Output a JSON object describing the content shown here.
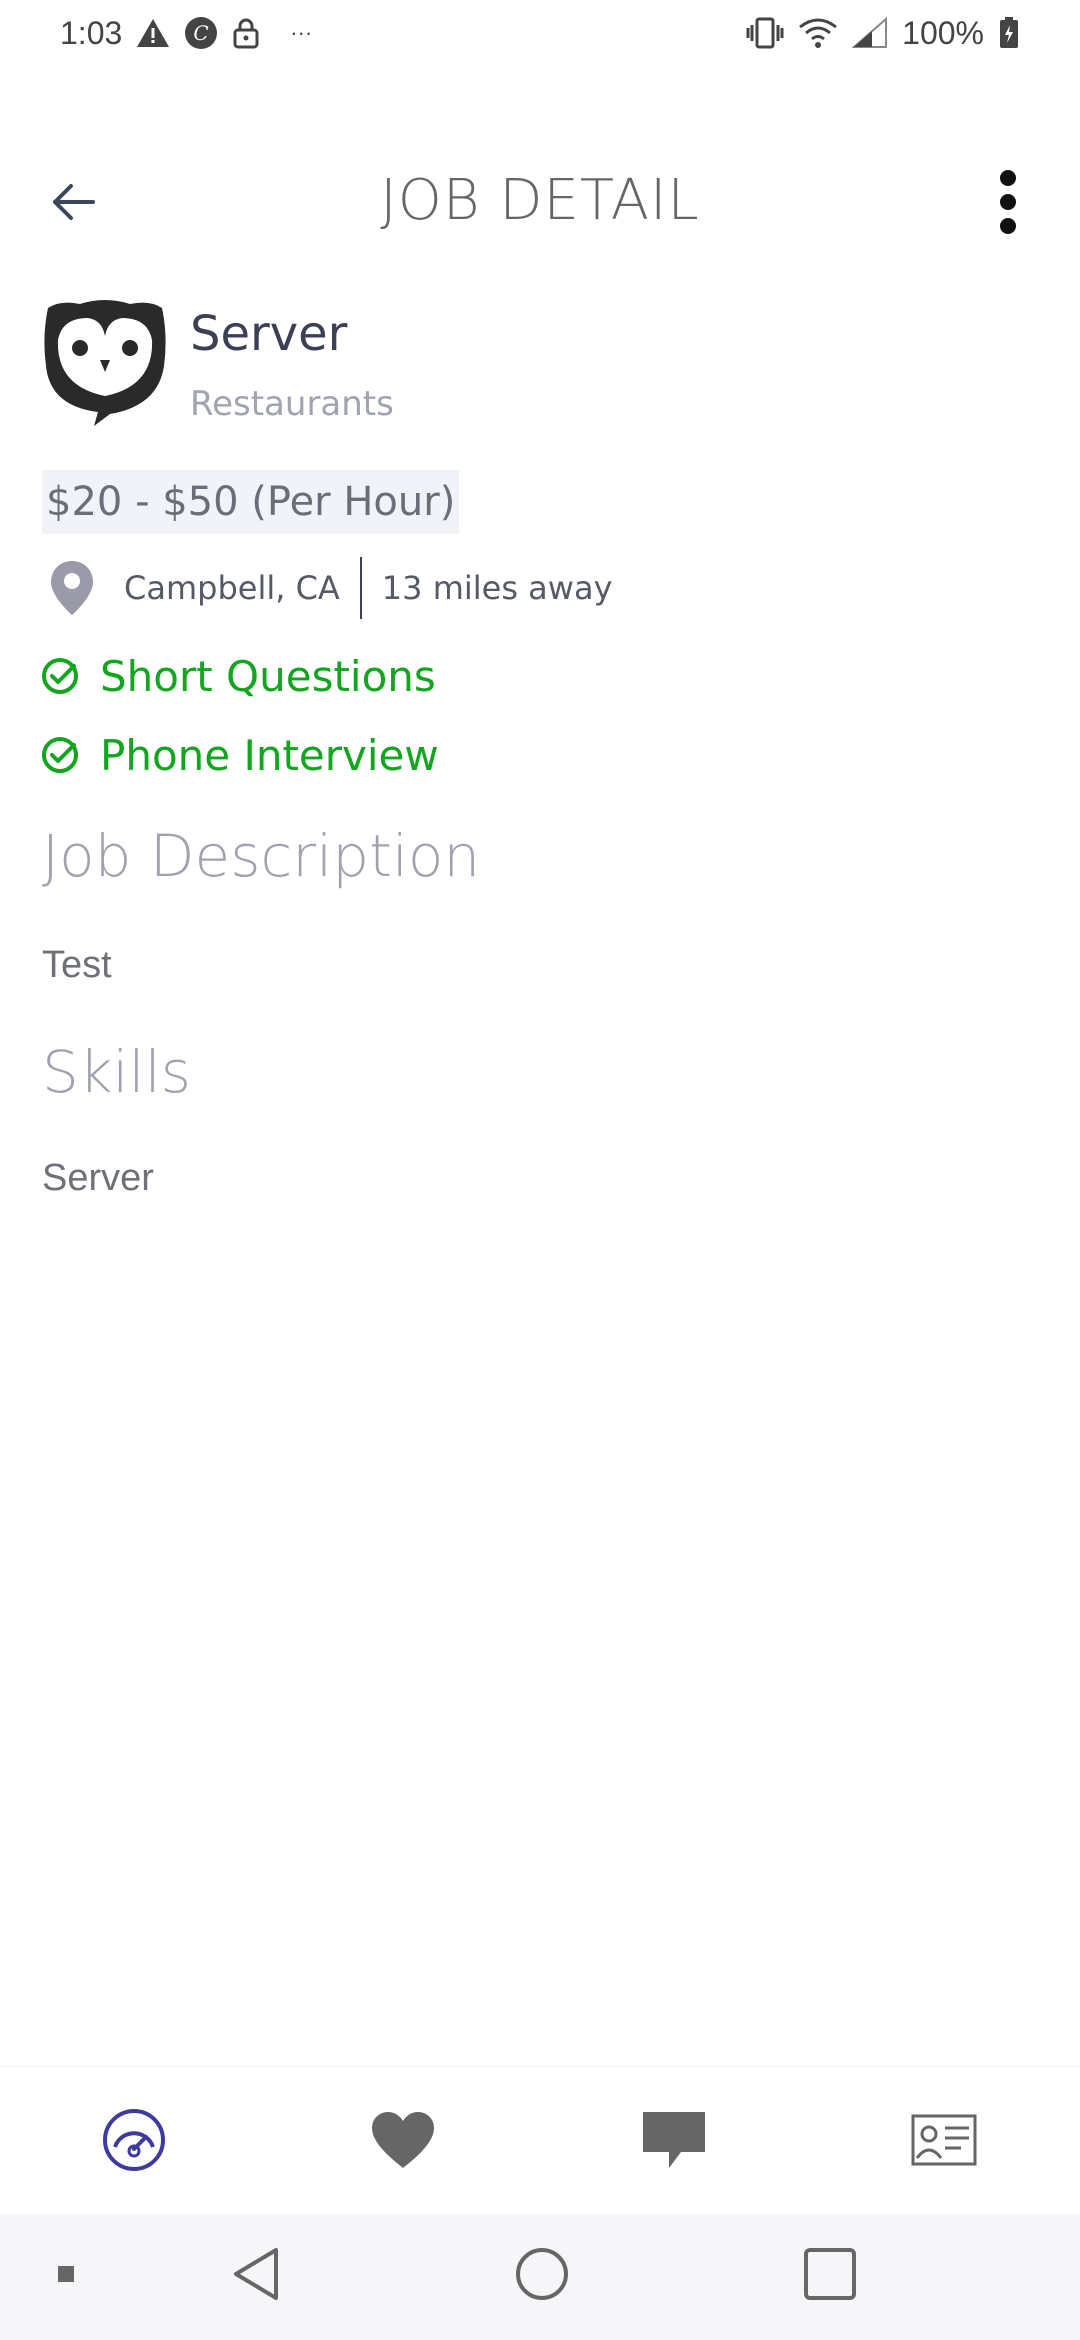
{
  "status_bar": {
    "time": "1:03",
    "more_indicator": "···",
    "battery": "100%",
    "icons_left": [
      "warning-icon",
      "c-app-icon",
      "lock-icon"
    ],
    "icons_right": [
      "vibrate-icon",
      "wifi-icon",
      "signal-icon",
      "battery-charging-icon"
    ]
  },
  "header": {
    "title": "JOB DETAIL",
    "back_icon": "arrow-left-icon",
    "more_icon": "more-vertical-icon"
  },
  "job": {
    "logo_icon": "owl-logo-icon",
    "title": "Server",
    "category": "Restaurants",
    "pay": "$20 - $50 (Per Hour)",
    "location": "Campbell, CA",
    "distance": "13 miles away",
    "requirements": [
      "Short Questions",
      "Phone Interview"
    ]
  },
  "sections": {
    "description_heading": "Job Description",
    "description_text": "Test",
    "skills_heading": "Skills",
    "skills_text": "Server"
  },
  "bottom_nav": {
    "items": [
      "dashboard-icon",
      "favorites-heart-icon",
      "messages-icon",
      "profile-card-icon"
    ],
    "active": "dashboard-icon",
    "active_color": "#3d3aa0",
    "inactive_color": "#666666"
  },
  "colors": {
    "accent_green": "#12a51e",
    "title_gray": "#666666"
  }
}
